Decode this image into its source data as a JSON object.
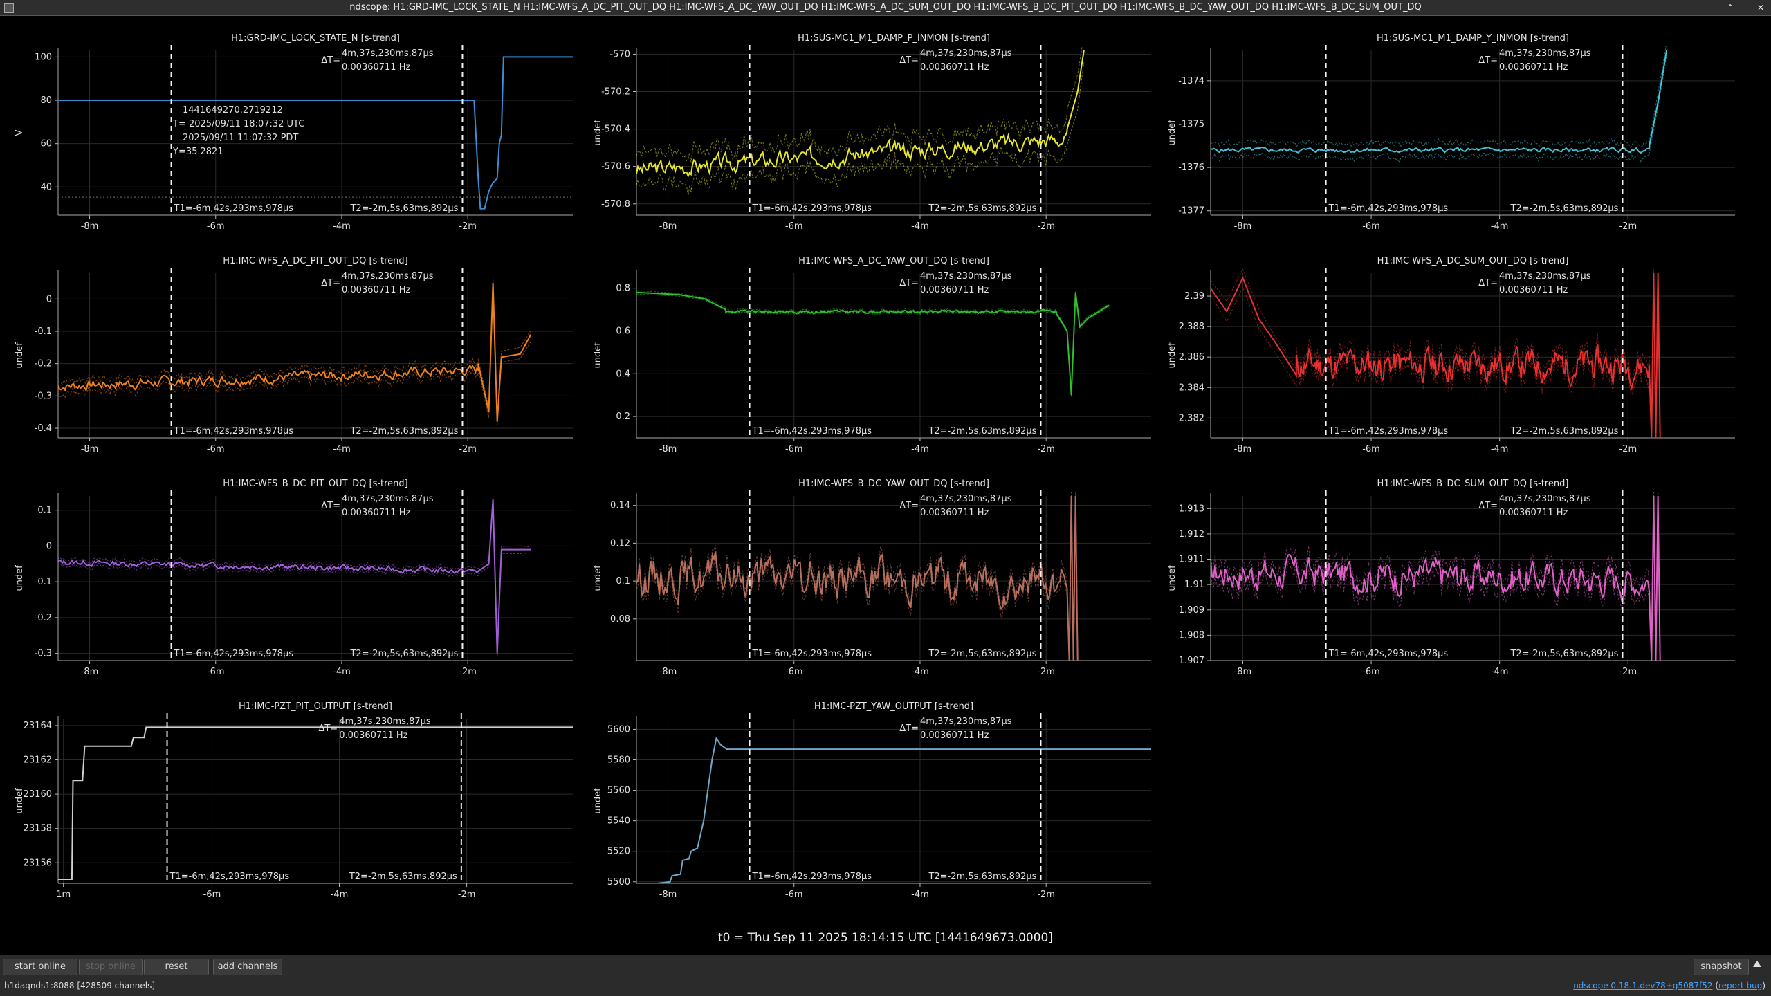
{
  "window": {
    "title": "ndscope: H1:GRD-IMC_LOCK_STATE_N H1:IMC-WFS_A_DC_PIT_OUT_DQ H1:IMC-WFS_A_DC_YAW_OUT_DQ H1:IMC-WFS_A_DC_SUM_OUT_DQ H1:IMC-WFS_B_DC_PIT_OUT_DQ H1:IMC-WFS_B_DC_YAW_OUT_DQ H1:IMC-WFS_B_DC_SUM_OUT_DQ",
    "controls": [
      "⌃",
      "–",
      "✕"
    ]
  },
  "cursor": {
    "delta_label": "ΔT=",
    "delta_time": "4m,37s,230ms,87µs",
    "delta_freq": "0.00360711 Hz",
    "t1_label": "T1=-6m,42s,293ms,978µs",
    "t2_label": "T2=-2m,5s,63ms,892µs",
    "t1_time": -402.293978,
    "t2_time": -125.063892
  },
  "crosshair": {
    "gps": "1441649270.2719212",
    "utc": "T= 2025/09/11 18:07:32 UTC",
    "pdt": "2025/09/11 11:07:32 PDT",
    "y": "Y=35.2821",
    "y_value": 35.2821
  },
  "t0_label": "t0 = Thu Sep 11 2025 18:14:15 UTC [1441649673.0000]",
  "toolbar": {
    "start_online": "start online",
    "stop_online": "stop online",
    "reset": "reset",
    "add_channels": "add channels",
    "snapshot": "snapshot",
    "collapse_icon": "triangle-up-icon"
  },
  "status": {
    "server": "h1daqnds1:8088  [428509 channels]",
    "version": "ndscope 0.18.1.dev78+g5087f52",
    "report_bug": "report bug"
  },
  "chart_data": [
    {
      "type": "line",
      "title": "H1:GRD-IMC_LOCK_STATE_N [s-trend]",
      "ylabel": "V",
      "color": "#3a8fd6",
      "xlim": [
        -510,
        -20
      ],
      "ylim": [
        27,
        103
      ],
      "yticks": [
        40,
        60,
        80,
        100
      ],
      "ytick_labels": [
        "40",
        "60",
        "80",
        "100"
      ],
      "xticks": [
        -480,
        -360,
        -240,
        -120
      ],
      "xtick_labels": [
        "-8m",
        "-6m",
        "-4m",
        "-2m"
      ],
      "crosshair": true,
      "kind": "steps",
      "points": [
        [
          -510,
          80
        ],
        [
          -114,
          80
        ],
        [
          -110,
          44
        ],
        [
          -108,
          30
        ],
        [
          -104,
          30
        ],
        [
          -100,
          38
        ],
        [
          -96,
          42
        ],
        [
          -92,
          44
        ],
        [
          -90,
          60
        ],
        [
          -88,
          64
        ],
        [
          -86,
          100
        ],
        [
          -20,
          100
        ]
      ]
    },
    {
      "type": "line",
      "title": "H1:SUS-MC1_M1_DAMP_P_INMON [s-trend]",
      "ylabel": "undef",
      "color": "#e6e62a",
      "xlim": [
        -510,
        -20
      ],
      "ylim": [
        -570.86,
        -569.98
      ],
      "yticks": [
        -570.8,
        -570.6,
        -570.4,
        -570.2,
        -570
      ],
      "ytick_labels": [
        "-570.8",
        "-570.6",
        "-570.4",
        "-570.2",
        "-570"
      ],
      "xticks": [
        -480,
        -360,
        -240,
        -120
      ],
      "xtick_labels": [
        "-8m",
        "-6m",
        "-4m",
        "-2m"
      ],
      "kind": "noise",
      "start": -570.62,
      "end": -570.45,
      "amp": 0.035,
      "band": 0.09,
      "seed": 3,
      "tail": [
        [
          -100,
          -570.4
        ],
        [
          -90,
          -570.2
        ],
        [
          -84,
          -569.98
        ]
      ]
    },
    {
      "type": "line",
      "title": "H1:SUS-MC1_M1_DAMP_Y_INMON [s-trend]",
      "ylabel": "undef",
      "color": "#3fc6d8",
      "xlim": [
        -510,
        -20
      ],
      "ylim": [
        -1377.1,
        -1373.3
      ],
      "yticks": [
        -1377,
        -1376,
        -1375,
        -1374
      ],
      "ytick_labels": [
        "-1377",
        "-1376",
        "-1375",
        "-1374"
      ],
      "xticks": [
        -480,
        -360,
        -240,
        -120
      ],
      "xtick_labels": [
        "-8m",
        "-6m",
        "-4m",
        "-2m"
      ],
      "kind": "noise",
      "start": -1375.6,
      "end": -1375.6,
      "amp": 0.04,
      "band": 0.18,
      "seed": 5,
      "tail": [
        [
          -100,
          -1375.5
        ],
        [
          -92,
          -1374.5
        ],
        [
          -84,
          -1373.3
        ]
      ]
    },
    {
      "type": "line",
      "title": "H1:IMC-WFS_A_DC_PIT_OUT_DQ [s-trend]",
      "ylabel": "undef",
      "color": "#f0821e",
      "xlim": [
        -510,
        -20
      ],
      "ylim": [
        -0.43,
        0.08
      ],
      "yticks": [
        -0.4,
        -0.3,
        -0.2,
        -0.1,
        0
      ],
      "ytick_labels": [
        "-0.4",
        "-0.3",
        "-0.2",
        "-0.1",
        "0"
      ],
      "xticks": [
        -480,
        -360,
        -240,
        -120
      ],
      "xtick_labels": [
        "-8m",
        "-6m",
        "-4m",
        "-2m"
      ],
      "kind": "noise",
      "start": -0.27,
      "end": -0.22,
      "amp": 0.012,
      "band": 0.02,
      "seed": 7,
      "tail": [
        [
          -110,
          -0.2
        ],
        [
          -100,
          -0.35
        ],
        [
          -96,
          0.05
        ],
        [
          -92,
          -0.38
        ],
        [
          -88,
          -0.18
        ],
        [
          -70,
          -0.17
        ],
        [
          -60,
          -0.11
        ]
      ]
    },
    {
      "type": "line",
      "title": "H1:IMC-WFS_A_DC_YAW_OUT_DQ [s-trend]",
      "ylabel": "undef",
      "color": "#2ec02e",
      "xlim": [
        -510,
        -20
      ],
      "ylim": [
        0.1,
        0.87
      ],
      "yticks": [
        0.2,
        0.4,
        0.6,
        0.8
      ],
      "ytick_labels": [
        "0.2",
        "0.4",
        "0.6",
        "0.8"
      ],
      "xticks": [
        -480,
        -360,
        -240,
        -120
      ],
      "xtick_labels": [
        "-8m",
        "-6m",
        "-4m",
        "-2m"
      ],
      "kind": "noise",
      "start": 0.69,
      "end": 0.69,
      "amp": 0.005,
      "band": 0.008,
      "seed": 9,
      "head": [
        [
          -510,
          0.78
        ],
        [
          -470,
          0.77
        ],
        [
          -445,
          0.75
        ],
        [
          -425,
          0.7
        ]
      ],
      "tail": [
        [
          -110,
          0.68
        ],
        [
          -100,
          0.6
        ],
        [
          -96,
          0.3
        ],
        [
          -92,
          0.78
        ],
        [
          -88,
          0.62
        ],
        [
          -80,
          0.66
        ],
        [
          -60,
          0.72
        ]
      ]
    },
    {
      "type": "line",
      "title": "H1:IMC-WFS_A_DC_SUM_OUT_DQ [s-trend]",
      "ylabel": "undef",
      "color": "#e83030",
      "xlim": [
        -510,
        -20
      ],
      "ylim": [
        2.3807,
        2.3915
      ],
      "yticks": [
        2.382,
        2.384,
        2.386,
        2.388,
        2.39
      ],
      "ytick_labels": [
        "2.382",
        "2.384",
        "2.386",
        "2.388",
        "2.39"
      ],
      "xticks": [
        -480,
        -360,
        -240,
        -120
      ],
      "xtick_labels": [
        "-8m",
        "-6m",
        "-4m",
        "-2m"
      ],
      "kind": "noise",
      "start": 2.3855,
      "end": 2.3855,
      "amp": 0.0008,
      "band": 0.0006,
      "seed": 11,
      "head": [
        [
          -510,
          2.3905
        ],
        [
          -495,
          2.389
        ],
        [
          -480,
          2.3912
        ],
        [
          -465,
          2.3885
        ],
        [
          -450,
          2.387
        ],
        [
          -430,
          2.3848
        ]
      ],
      "tail": [
        [
          -100,
          2.385
        ],
        [
          -98,
          2.3807
        ],
        [
          -96,
          2.3915
        ],
        [
          -94,
          2.3807
        ],
        [
          -92,
          2.3915
        ],
        [
          -90,
          2.3807
        ]
      ]
    },
    {
      "type": "line",
      "title": "H1:IMC-WFS_B_DC_PIT_OUT_DQ [s-trend]",
      "ylabel": "undef",
      "color": "#a35fd8",
      "xlim": [
        -510,
        -20
      ],
      "ylim": [
        -0.32,
        0.14
      ],
      "yticks": [
        -0.3,
        -0.2,
        -0.1,
        0,
        0.1
      ],
      "ytick_labels": [
        "-0.3",
        "-0.2",
        "-0.1",
        "0",
        "0.1"
      ],
      "xticks": [
        -480,
        -360,
        -240,
        -120
      ],
      "xtick_labels": [
        "-8m",
        "-6m",
        "-4m",
        "-2m"
      ],
      "kind": "noise",
      "start": -0.045,
      "end": -0.07,
      "amp": 0.006,
      "band": 0.01,
      "seed": 13,
      "tail": [
        [
          -110,
          -0.07
        ],
        [
          -100,
          -0.05
        ],
        [
          -96,
          0.13
        ],
        [
          -92,
          -0.3
        ],
        [
          -88,
          -0.01
        ],
        [
          -70,
          -0.01
        ],
        [
          -60,
          -0.01
        ]
      ]
    },
    {
      "type": "line",
      "title": "H1:IMC-WFS_B_DC_YAW_OUT_DQ [s-trend]",
      "ylabel": "undef",
      "color": "#b8705e",
      "xlim": [
        -510,
        -20
      ],
      "ylim": [
        0.058,
        0.145
      ],
      "yticks": [
        0.08,
        0.1,
        0.12,
        0.14
      ],
      "ytick_labels": [
        "0.08",
        "0.1",
        "0.12",
        "0.14"
      ],
      "xticks": [
        -480,
        -360,
        -240,
        -120
      ],
      "xtick_labels": [
        "-8m",
        "-6m",
        "-4m",
        "-2m"
      ],
      "kind": "noise",
      "start": 0.103,
      "end": 0.1,
      "amp": 0.008,
      "band": 0.004,
      "seed": 15,
      "tail": [
        [
          -100,
          0.095
        ],
        [
          -98,
          0.058
        ],
        [
          -96,
          0.145
        ],
        [
          -94,
          0.058
        ],
        [
          -92,
          0.145
        ],
        [
          -90,
          0.058
        ]
      ]
    },
    {
      "type": "line",
      "title": "H1:IMC-WFS_B_DC_SUM_OUT_DQ [s-trend]",
      "ylabel": "undef",
      "color": "#e060c8",
      "xlim": [
        -510,
        -20
      ],
      "ylim": [
        1.907,
        1.9135
      ],
      "yticks": [
        1.907,
        1.908,
        1.909,
        1.91,
        1.911,
        1.912,
        1.913
      ],
      "ytick_labels": [
        "1.907",
        "1.908",
        "1.909",
        "1.91",
        "1.911",
        "1.912",
        "1.913"
      ],
      "xticks": [
        -480,
        -360,
        -240,
        -120
      ],
      "xtick_labels": [
        "-8m",
        "-6m",
        "-4m",
        "-2m"
      ],
      "kind": "noise",
      "start": 1.9105,
      "end": 1.9102,
      "amp": 0.0005,
      "band": 0.0004,
      "seed": 17,
      "tail": [
        [
          -100,
          1.9095
        ],
        [
          -98,
          1.907
        ],
        [
          -96,
          1.9135
        ],
        [
          -94,
          1.907
        ],
        [
          -92,
          1.9135
        ],
        [
          -90,
          1.907
        ]
      ]
    },
    {
      "type": "line",
      "title": "H1:IMC-PZT_PIT_OUTPUT [s-trend]",
      "ylabel": "undef",
      "color": "#cfcfcf",
      "xlim": [
        -505,
        -20
      ],
      "ylim": [
        23154.8,
        23164.4
      ],
      "yticks": [
        23156,
        23158,
        23160,
        23162,
        23164
      ],
      "ytick_labels": [
        "23156",
        "23158",
        "23160",
        "23162",
        "23164"
      ],
      "xticks": [
        -500,
        -360,
        -240,
        -120
      ],
      "xtick_labels": [
        "1m",
        "-6m",
        "-4m",
        "-2m"
      ],
      "kind": "steps",
      "points": [
        [
          -505,
          23155
        ],
        [
          -492,
          23155
        ],
        [
          -491,
          23160.8
        ],
        [
          -482,
          23160.8
        ],
        [
          -480,
          23162.8
        ],
        [
          -436,
          23162.8
        ],
        [
          -434,
          23163.3
        ],
        [
          -424,
          23163.3
        ],
        [
          -422,
          23163.9
        ],
        [
          -20,
          23163.9
        ]
      ]
    },
    {
      "type": "line",
      "title": "H1:IMC-PZT_YAW_OUTPUT [s-trend]",
      "ylabel": "undef",
      "color": "#6fa7c8",
      "xlim": [
        -510,
        -20
      ],
      "ylim": [
        5499,
        5607
      ],
      "yticks": [
        5500,
        5520,
        5540,
        5560,
        5580,
        5600
      ],
      "ytick_labels": [
        "5500",
        "5520",
        "5540",
        "5560",
        "5580",
        "5600"
      ],
      "xticks": [
        -480,
        -360,
        -240,
        -120
      ],
      "xtick_labels": [
        "-8m",
        "-6m",
        "-4m",
        "-2m"
      ],
      "kind": "steps",
      "points": [
        [
          -490,
          5499
        ],
        [
          -478,
          5500
        ],
        [
          -476,
          5504
        ],
        [
          -468,
          5505
        ],
        [
          -466,
          5514
        ],
        [
          -460,
          5515
        ],
        [
          -458,
          5520
        ],
        [
          -452,
          5522
        ],
        [
          -450,
          5528
        ],
        [
          -446,
          5540
        ],
        [
          -442,
          5560
        ],
        [
          -438,
          5580
        ],
        [
          -434,
          5594
        ],
        [
          -430,
          5590
        ],
        [
          -424,
          5587
        ],
        [
          -20,
          5587
        ]
      ]
    }
  ]
}
